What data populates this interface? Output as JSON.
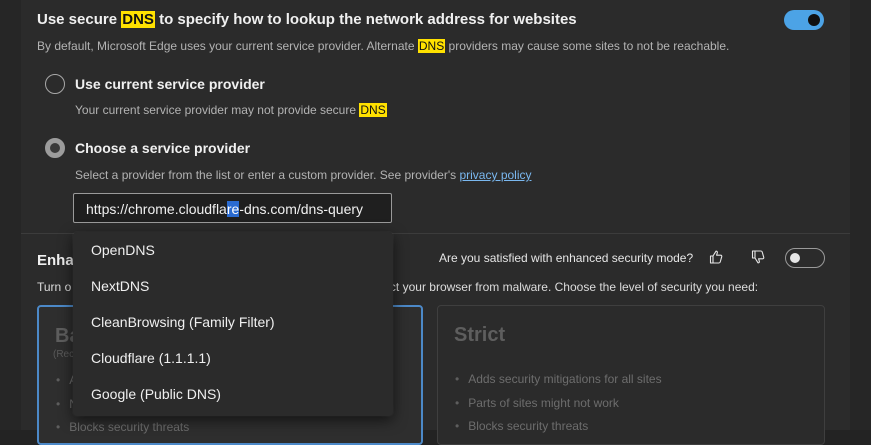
{
  "dns": {
    "title_before": "Use secure ",
    "title_highlight": "DNS",
    "title_after": " to specify how to lookup the network address for websites",
    "desc_before": "By default, Microsoft Edge uses your current service provider. Alternate ",
    "desc_highlight": "DNS",
    "desc_after": " providers may cause some sites to not be reachable.",
    "toggle_state": "on",
    "options": [
      {
        "title": "Use current service provider",
        "desc_before": "Your current service provider may not provide secure ",
        "desc_highlight": "DNS",
        "selected": false
      },
      {
        "title": "Choose a service provider",
        "desc_before": "Select a provider from the list or enter a custom provider. See provider's ",
        "link": "privacy policy",
        "selected": true
      }
    ],
    "input": {
      "before": "https://chrome.cloudfla",
      "selected": "re",
      "after": "-dns.com/dns-query"
    },
    "dropdown_items": [
      "OpenDNS",
      "NextDNS",
      "CleanBrowsing (Family Filter)",
      "Cloudflare (1.1.1.1)",
      "Google (Public DNS)"
    ]
  },
  "enhanced": {
    "title_visible": "Enha",
    "desc_visible_start": "Turn o",
    "desc_visible_end": "ect your browser from malware. Choose the level of security you need:",
    "question": "Are you satisfied with enhanced security mode?",
    "toggle_state": "off",
    "thumbs_up_icon": "thumbs-up-icon",
    "thumbs_down_icon": "thumbs-down-icon",
    "basic": {
      "name": "Ba",
      "sub": "(Rec",
      "bullets": [
        "A",
        "N",
        "Blocks security threats"
      ]
    },
    "strict": {
      "name": "Strict",
      "bullets": [
        "Adds security mitigations for all sites",
        "Parts of sites might not work",
        "Blocks security threats"
      ]
    }
  },
  "colors": {
    "highlight": "#ffe100",
    "accent": "#4ca3e6",
    "link": "#7ab8f0",
    "background": "#2b2b2b"
  }
}
